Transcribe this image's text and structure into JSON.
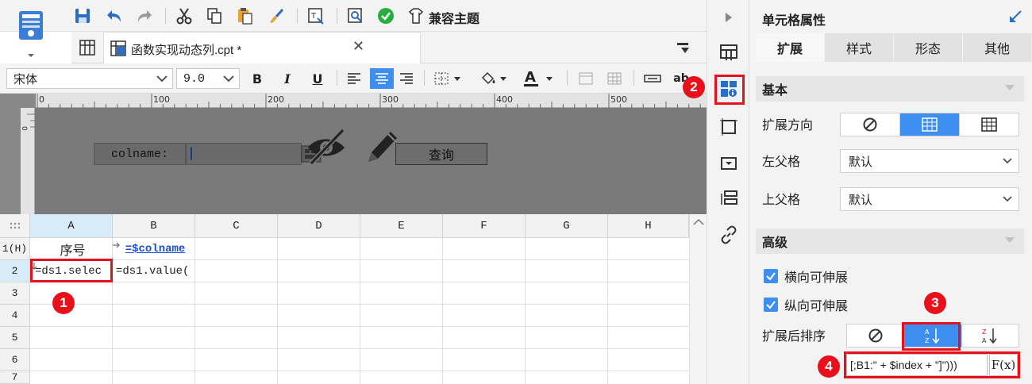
{
  "toolbar": {
    "theme_label": "兼容主题"
  },
  "tab": {
    "title": "函数实现动态列.cpt *",
    "close": "✕"
  },
  "format": {
    "font_name": "宋体",
    "font_size": "9.0",
    "bold": "B",
    "italic": "I",
    "underline": "U",
    "overflow_text": "ab"
  },
  "ruler": {
    "labels": [
      "0",
      "100",
      "200",
      "300",
      "400",
      "500"
    ]
  },
  "form": {
    "label": "colname:",
    "query_button": "查询"
  },
  "grid": {
    "columns": [
      "A",
      "B",
      "C",
      "D",
      "E",
      "F",
      "G",
      "H"
    ],
    "rows": [
      "1(H)",
      "2",
      "3",
      "4",
      "5",
      "6",
      "7"
    ],
    "cells": {
      "a1": "序号",
      "b1": "=$colname",
      "a2": "=ds1.selec",
      "b2": "=ds1.value("
    }
  },
  "props": {
    "title": "单元格属性",
    "tabs": [
      "扩展",
      "样式",
      "形态",
      "其他"
    ],
    "section_basic": "基本",
    "expand_direction_label": "扩展方向",
    "left_parent_label": "左父格",
    "left_parent_value": "默认",
    "upper_parent_label": "上父格",
    "upper_parent_value": "默认",
    "section_advanced": "高级",
    "horizontal_expand": "横向可伸展",
    "vertical_expand": "纵向可伸展",
    "sort_label": "扩展后排序",
    "formula": "[;B1:\" + $index + \"]\")))",
    "fx": "F(x)"
  },
  "annotations": [
    "1",
    "2",
    "3",
    "4"
  ],
  "colors": {
    "accent": "#3d8ef0",
    "annotation": "#e8101a",
    "link": "#1a4fd0"
  }
}
